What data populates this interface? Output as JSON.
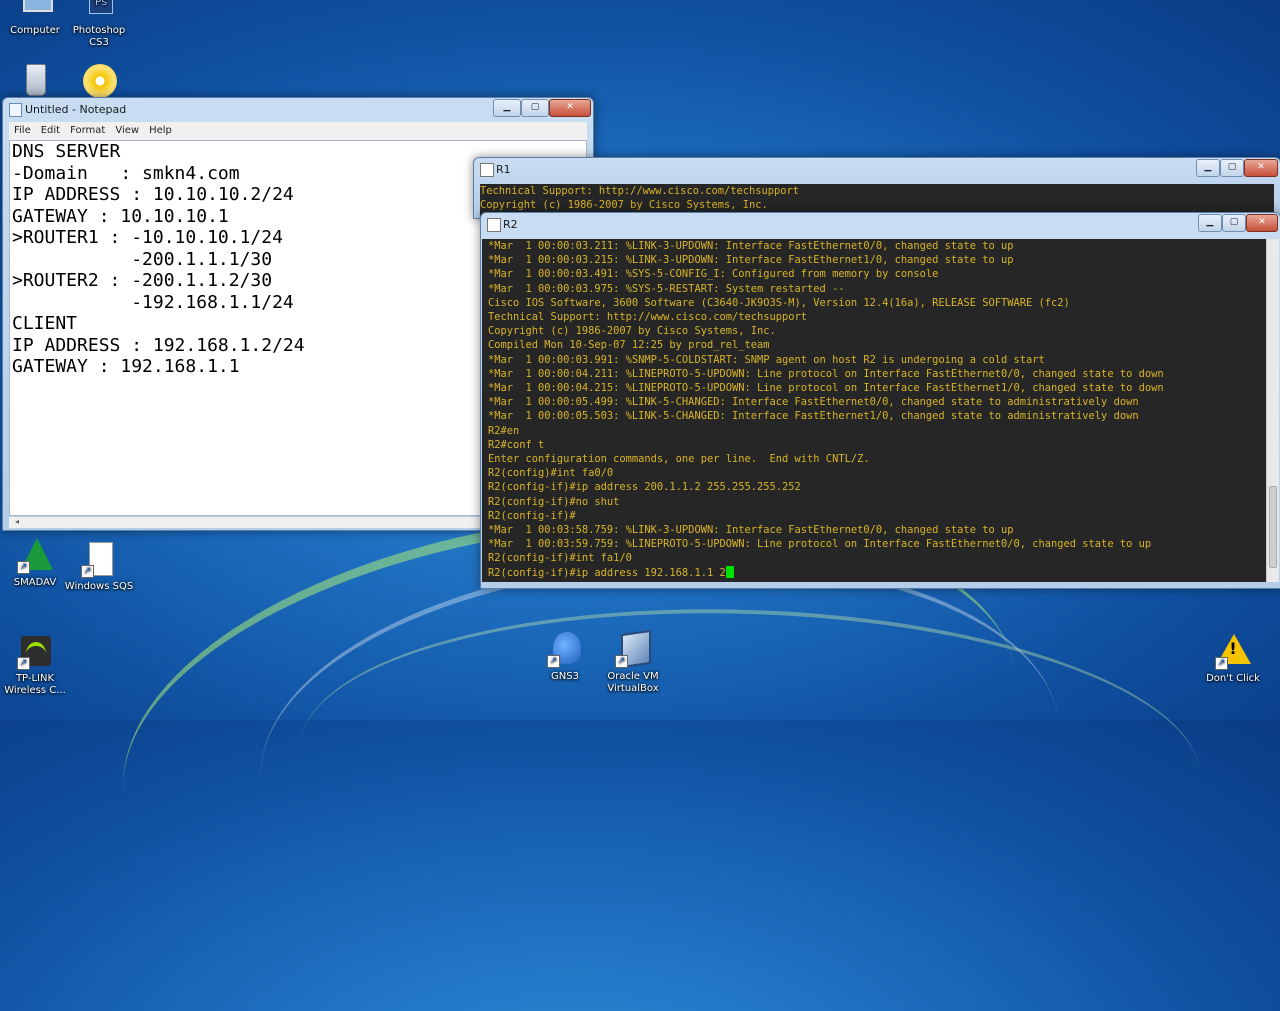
{
  "desktop": {
    "icons": [
      {
        "id": "computer",
        "label": "Computer",
        "icon": "computer-icon"
      },
      {
        "id": "photoshop",
        "label": "Photoshop CS3",
        "icon": "photoshop-icon"
      },
      {
        "id": "recycle",
        "label": "",
        "icon": "recycle-bin-icon"
      },
      {
        "id": "dvd",
        "label": "",
        "icon": "dvd-icon"
      },
      {
        "id": "smadav",
        "label": "SMADAV",
        "icon": "smadav-icon"
      },
      {
        "id": "windows_sqs",
        "label": "Windows SQS",
        "icon": "document-icon"
      },
      {
        "id": "tplink",
        "label": "TP-LINK Wireless C...",
        "icon": "wifi-icon"
      },
      {
        "id": "gns3",
        "label": "GNS3",
        "icon": "gns3-icon"
      },
      {
        "id": "virtualbox",
        "label": "Oracle VM VirtualBox",
        "icon": "virtualbox-icon"
      },
      {
        "id": "dontclick",
        "label": "Don't Click",
        "icon": "warning-icon"
      }
    ]
  },
  "notepad": {
    "title": "Untitled - Notepad",
    "menu": [
      "File",
      "Edit",
      "Format",
      "View",
      "Help"
    ],
    "lines": [
      "DNS SERVER",
      "-Domain   : smkn4.com",
      "IP ADDRESS : 10.10.10.2/24",
      "GATEWAY : 10.10.10.1",
      "",
      "",
      ">ROUTER1 : -10.10.10.1/24",
      "           -200.1.1.1/30",
      "",
      ">ROUTER2 : -200.1.1.2/30",
      "           -192.168.1.1/24",
      "",
      "",
      "CLIENT",
      "IP ADDRESS : 192.168.1.2/24",
      "GATEWAY : 192.168.1.1"
    ]
  },
  "r1": {
    "title": "R1",
    "lines": [
      "Technical Support: http://www.cisco.com/techsupport",
      "Copyright (c) 1986-2007 by Cisco Systems, Inc."
    ]
  },
  "r2": {
    "title": "R2",
    "lines": [
      "*Mar  1 00:00:03.211: %LINK-3-UPDOWN: Interface FastEthernet0/0, changed state to up",
      "*Mar  1 00:00:03.215: %LINK-3-UPDOWN: Interface FastEthernet1/0, changed state to up",
      "*Mar  1 00:00:03.491: %SYS-5-CONFIG_I: Configured from memory by console",
      "*Mar  1 00:00:03.975: %SYS-5-RESTART: System restarted --",
      "Cisco IOS Software, 3600 Software (C3640-JK9O3S-M), Version 12.4(16a), RELEASE SOFTWARE (fc2)",
      "Technical Support: http://www.cisco.com/techsupport",
      "Copyright (c) 1986-2007 by Cisco Systems, Inc.",
      "Compiled Mon 10-Sep-07 12:25 by prod_rel_team",
      "*Mar  1 00:00:03.991: %SNMP-5-COLDSTART: SNMP agent on host R2 is undergoing a cold start",
      "*Mar  1 00:00:04.211: %LINEPROTO-5-UPDOWN: Line protocol on Interface FastEthernet0/0, changed state to down",
      "*Mar  1 00:00:04.215: %LINEPROTO-5-UPDOWN: Line protocol on Interface FastEthernet1/0, changed state to down",
      "*Mar  1 00:00:05.499: %LINK-5-CHANGED: Interface FastEthernet0/0, changed state to administratively down",
      "*Mar  1 00:00:05.503: %LINK-5-CHANGED: Interface FastEthernet1/0, changed state to administratively down",
      "R2#en",
      "R2#conf t",
      "Enter configuration commands, one per line.  End with CNTL/Z.",
      "R2(config)#int fa0/0",
      "R2(config-if)#ip address 200.1.1.2 255.255.255.252",
      "R2(config-if)#no shut",
      "R2(config-if)#",
      "*Mar  1 00:03:58.759: %LINK-3-UPDOWN: Interface FastEthernet0/0, changed state to up",
      "*Mar  1 00:03:59.759: %LINEPROTO-5-UPDOWN: Line protocol on Interface FastEthernet0/0, changed state to up",
      "R2(config-if)#int fa1/0",
      "R2(config-if)#ip address 192.168.1.1 2"
    ]
  },
  "colors": {
    "terminal_bg": "#262626",
    "terminal_text": "#d8b428",
    "cursor": "#00e000"
  }
}
